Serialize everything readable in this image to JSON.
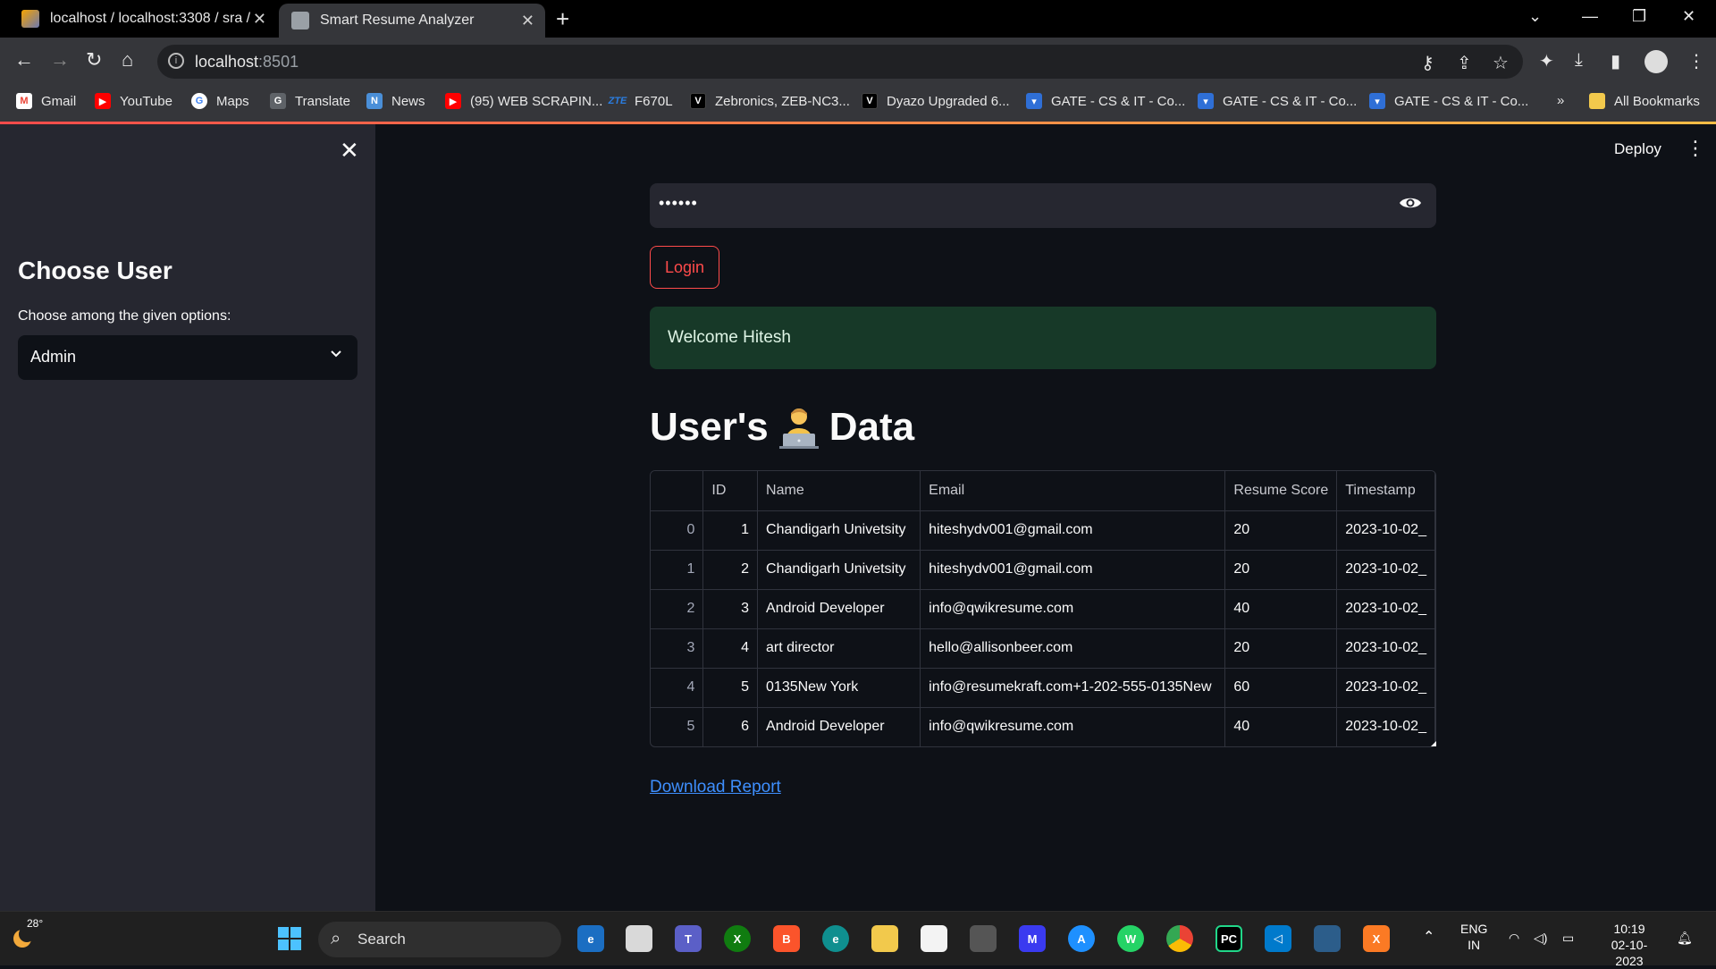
{
  "browser": {
    "tabs": [
      {
        "title": "localhost / localhost:3308 / sra / "
      },
      {
        "title": "Smart Resume Analyzer"
      }
    ],
    "url_host": "localhost",
    "url_port": ":8501",
    "bookmarks": [
      {
        "label": "Gmail",
        "icon": "gmail-icon"
      },
      {
        "label": "YouTube",
        "icon": "youtube-icon"
      },
      {
        "label": "Maps",
        "icon": "google-icon"
      },
      {
        "label": "Translate",
        "icon": "translate-icon"
      },
      {
        "label": "News",
        "icon": "news-icon"
      },
      {
        "label": "(95) WEB SCRAPIN...",
        "icon": "youtube-icon"
      },
      {
        "label": "F670L",
        "icon": "zte-icon"
      },
      {
        "label": "Zebronics, ZEB-NC3...",
        "icon": "v-icon"
      },
      {
        "label": "Dyazo Upgraded 6...",
        "icon": "v-icon"
      },
      {
        "label": "GATE - CS & IT - Co...",
        "icon": "gate-icon"
      },
      {
        "label": "GATE - CS & IT - Co...",
        "icon": "gate-icon"
      },
      {
        "label": "GATE - CS & IT - Co...",
        "icon": "gate-icon"
      }
    ],
    "more_bookmarks": "»",
    "all_bookmarks": "All Bookmarks"
  },
  "sidebar": {
    "title": "Choose User",
    "select_label": "Choose among the given options:",
    "select_value": "Admin"
  },
  "header": {
    "deploy": "Deploy"
  },
  "main": {
    "password_mask": "••••••",
    "login_label": "Login",
    "success_message": "Welcome Hitesh",
    "heading_pre": "User's",
    "heading_post": "Data",
    "download_link": "Download Report"
  },
  "table": {
    "columns": [
      "",
      "ID",
      "Name",
      "Email",
      "Resume Score",
      "Timestamp"
    ],
    "rows": [
      [
        "0",
        "1",
        "Chandigarh Univetsity",
        "hiteshydv001@gmail.com",
        "20",
        "2023-10-02_"
      ],
      [
        "1",
        "2",
        "Chandigarh Univetsity",
        "hiteshydv001@gmail.com",
        "20",
        "2023-10-02_"
      ],
      [
        "2",
        "3",
        "Android Developer",
        "info@qwikresume.com",
        "40",
        "2023-10-02_"
      ],
      [
        "3",
        "4",
        "art director",
        "hello@allisonbeer.com",
        "20",
        "2023-10-02_"
      ],
      [
        "4",
        "5",
        "0135New York",
        "info@resumekraft.com+1-202-555-0135New",
        "60",
        "2023-10-02_"
      ],
      [
        "5",
        "6",
        "Android Developer",
        "info@qwikresume.com",
        "40",
        "2023-10-02_"
      ]
    ]
  },
  "taskbar": {
    "temperature": "28°",
    "search_label": "Search",
    "language_1": "ENG",
    "language_2": "IN",
    "time": "10:19",
    "date": "02-10-2023"
  },
  "colors": {
    "accent": "#ff4b4b",
    "link": "#3e8ffe",
    "success_bg": "#173928",
    "sidebar_bg": "#262730",
    "app_bg": "#0e1117"
  }
}
